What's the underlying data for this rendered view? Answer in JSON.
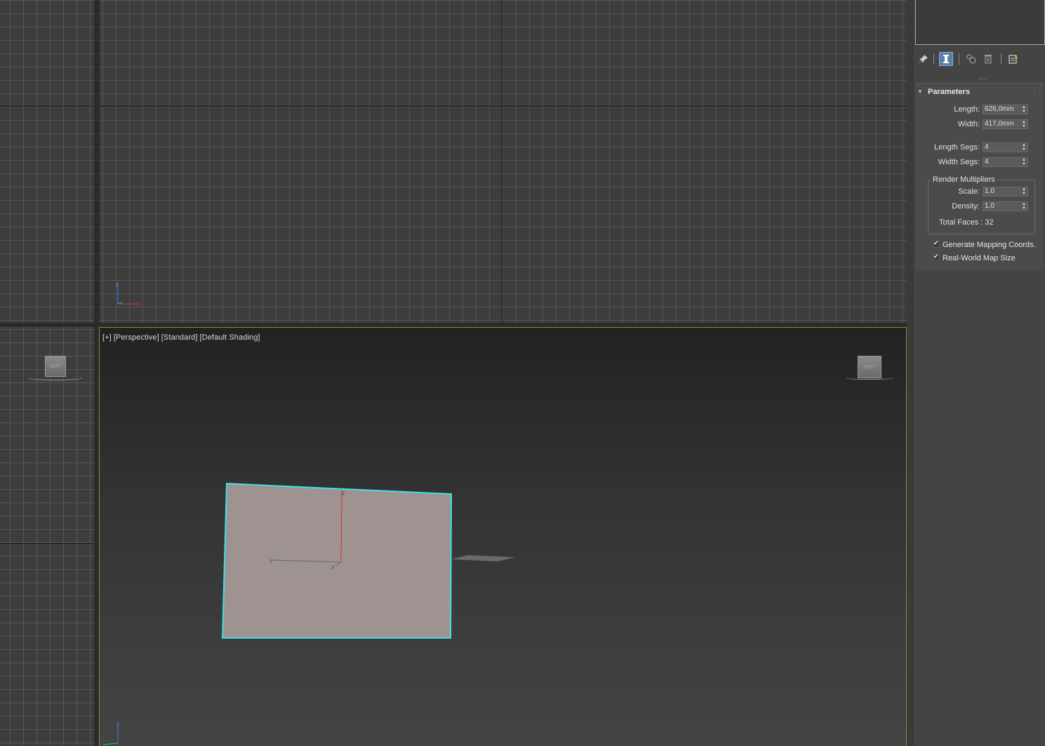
{
  "viewports": {
    "perspective": {
      "label_plus": "[+]",
      "label_view": "[Perspective]",
      "label_standard": "[Standard]",
      "label_shading": "[Default Shading]"
    },
    "viewcube_face": "LEFT",
    "axis_letters": {
      "x": "x",
      "y": "y",
      "z": "z"
    }
  },
  "command_panel": {
    "rollout_title": "Parameters",
    "length": {
      "label": "Length:",
      "value": "626,0mm"
    },
    "width": {
      "label": "Width:",
      "value": "417,0mm"
    },
    "length_segs": {
      "label": "Length Segs:",
      "value": "4"
    },
    "width_segs": {
      "label": "Width Segs:",
      "value": "4"
    },
    "render_multipliers": {
      "legend": "Render Multipliers",
      "scale": {
        "label": "Scale:",
        "value": "1,0"
      },
      "density": {
        "label": "Density:",
        "value": "1,0"
      },
      "total_faces": "Total Faces : 32"
    },
    "generate_mapping": {
      "label": "Generate Mapping Coords.",
      "checked": true
    },
    "real_world": {
      "label": "Real-World Map Size",
      "checked": true
    },
    "toolbar_icons": [
      "pin-stack-icon",
      "show-end-result-icon",
      "make-unique-icon",
      "remove-modifier-icon",
      "configure-modifier-sets-icon"
    ]
  },
  "colors": {
    "selection": "#40e0e8",
    "plane_fill": "#9e9390",
    "active_border": "#9a8530",
    "axis_x": "#c0392b",
    "axis_y": "#27ae60",
    "axis_z": "#3b6fd6"
  }
}
